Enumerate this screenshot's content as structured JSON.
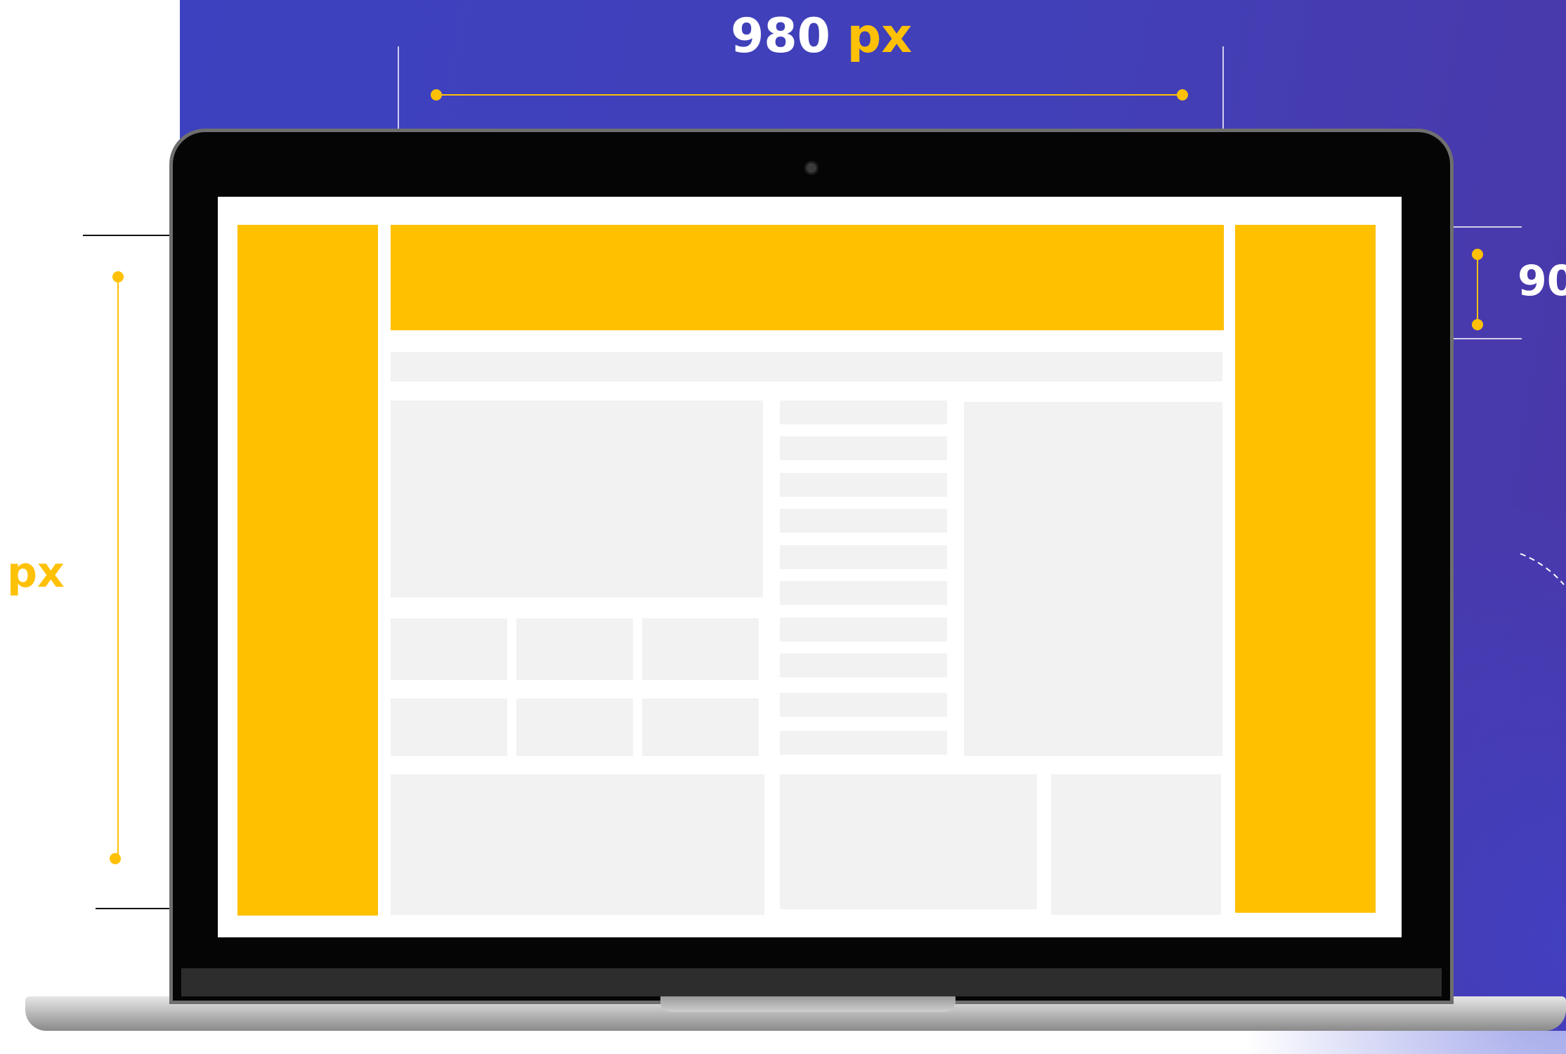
{
  "dimensions": {
    "width": {
      "value": "980",
      "unit": "px"
    },
    "height": {
      "value": "",
      "unit": "px"
    },
    "banner_height": {
      "value": "90",
      "unit": ""
    }
  },
  "colors": {
    "background_panel": "#3d41bf",
    "accent": "#ffc000",
    "placeholder_block": "#f2f2f2",
    "laptop_bezel": "#050505"
  },
  "layout": {
    "left_skyscraper_ad": "yellow",
    "top_leaderboard_ad": "yellow",
    "right_skyscraper_ad": "yellow"
  }
}
